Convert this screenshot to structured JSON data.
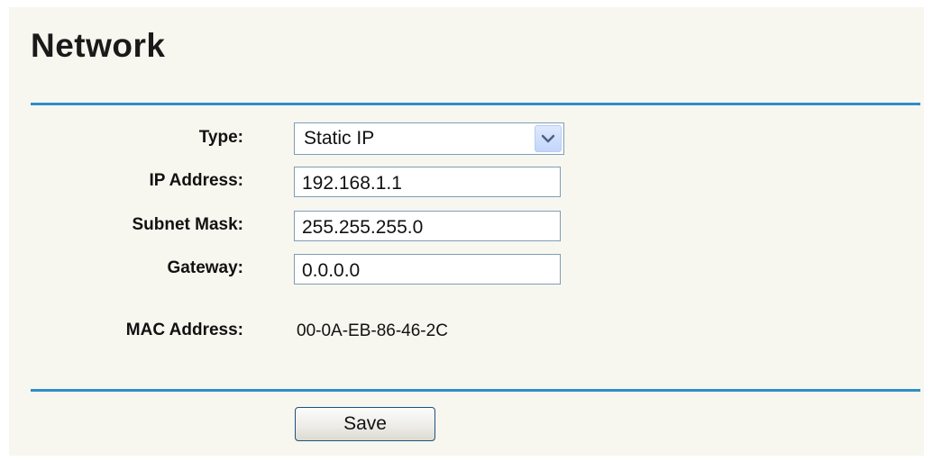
{
  "page": {
    "title": "Network"
  },
  "form": {
    "type": {
      "label": "Type:",
      "value": "Static IP"
    },
    "ip_address": {
      "label": "IP Address:",
      "value": "192.168.1.1"
    },
    "subnet_mask": {
      "label": "Subnet Mask:",
      "value": "255.255.255.0"
    },
    "gateway": {
      "label": "Gateway:",
      "value": "0.0.0.0"
    },
    "mac_address": {
      "label": "MAC Address:",
      "value": "00-0A-EB-86-46-2C"
    }
  },
  "actions": {
    "save_label": "Save"
  },
  "colors": {
    "accent": "#2f8ec8",
    "panel_background": "#f7f7ef"
  }
}
